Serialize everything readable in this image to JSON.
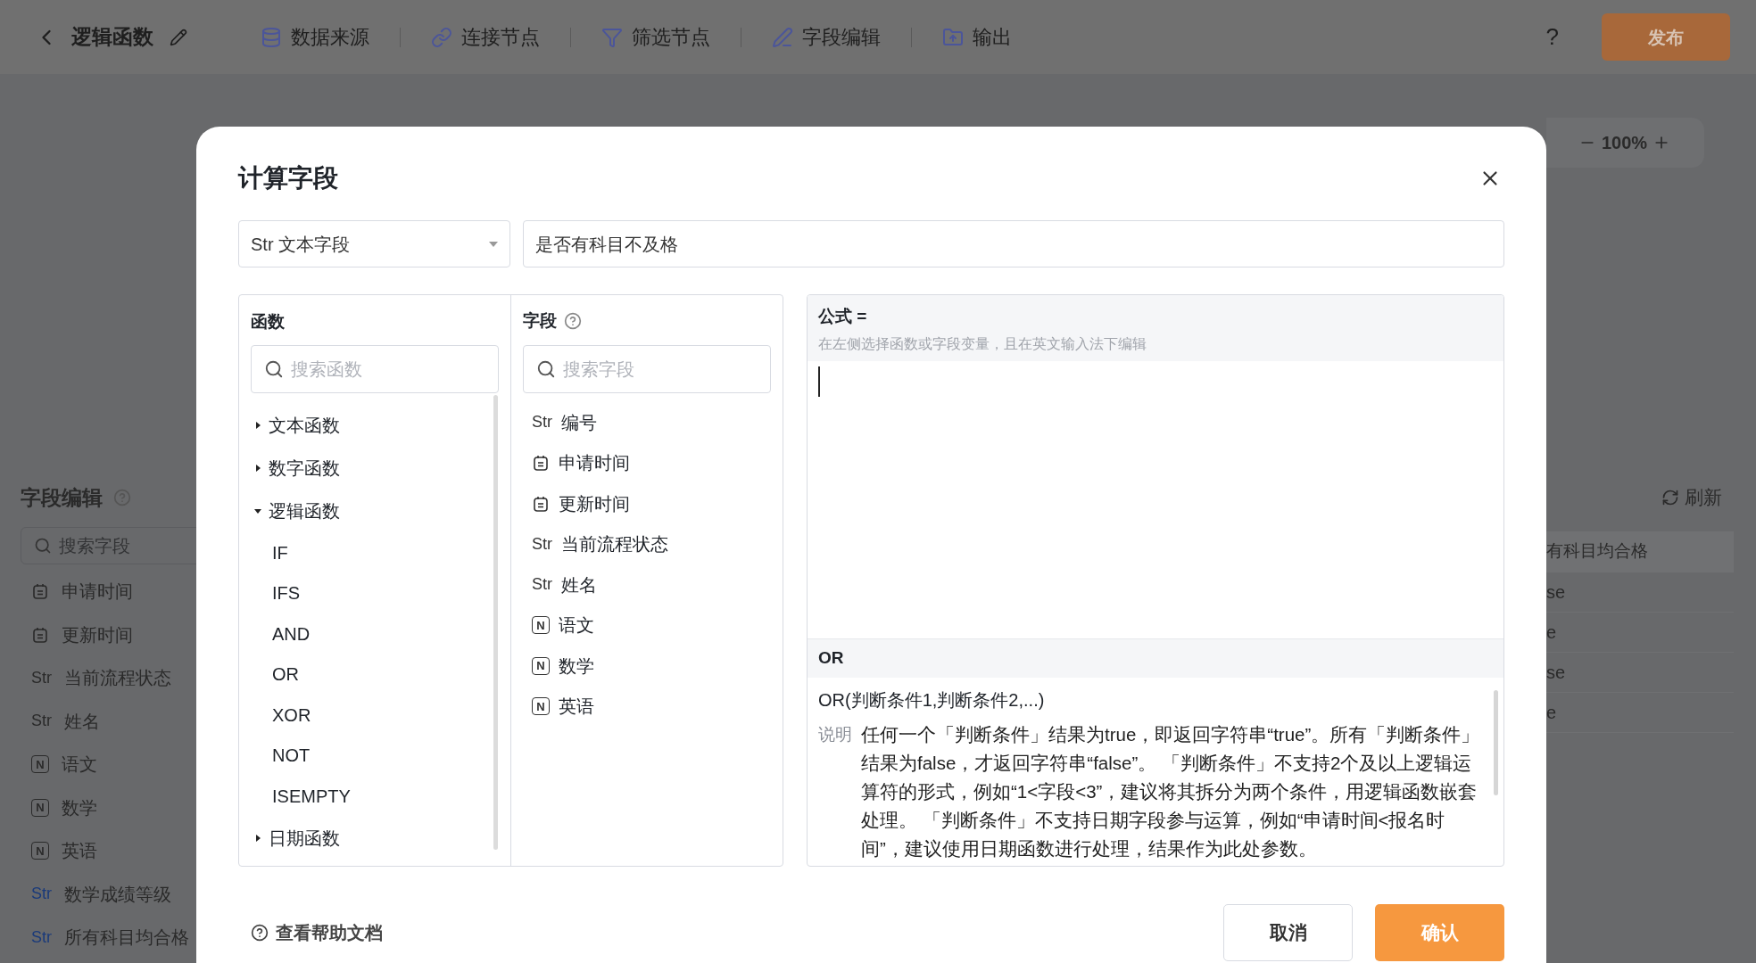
{
  "top_bar": {
    "title": "逻辑函数",
    "nav": [
      {
        "label": "数据来源",
        "kind": "source"
      },
      {
        "label": "连接节点",
        "kind": "join"
      },
      {
        "label": "筛选节点",
        "kind": "filter"
      },
      {
        "label": "字段编辑",
        "kind": "edit"
      },
      {
        "label": "输出",
        "kind": "output"
      }
    ],
    "help": "?",
    "publish": "发布"
  },
  "sidebar": {
    "title": "字段编辑",
    "search_placeholder": "搜索字段",
    "items": [
      {
        "kind": "date",
        "label": "申请时间"
      },
      {
        "kind": "date",
        "label": "更新时间"
      },
      {
        "kind": "str",
        "tag": "Str",
        "label": "当前流程状态"
      },
      {
        "kind": "str",
        "tag": "Str",
        "label": "姓名"
      },
      {
        "kind": "num",
        "tag": "N",
        "label": "语文"
      },
      {
        "kind": "num",
        "tag": "N",
        "label": "数学"
      },
      {
        "kind": "num",
        "tag": "N",
        "label": "英语"
      },
      {
        "kind": "calc",
        "tag": "Str",
        "label": "数学成绩等级"
      },
      {
        "kind": "calc",
        "tag": "Str",
        "label": "所有科目均合格"
      }
    ]
  },
  "zoom": {
    "value": "100%"
  },
  "refresh": "刷新",
  "table": {
    "header": "有科目均合格",
    "rows": [
      "se",
      "e",
      "se",
      "e"
    ]
  },
  "dialog": {
    "title": "计算字段",
    "type_select": "Str 文本字段",
    "name_value": "是否有科目不及格",
    "functions": {
      "title": "函数",
      "search_placeholder": "搜索函数",
      "categories": [
        {
          "label": "文本函数",
          "expanded": false
        },
        {
          "label": "数字函数",
          "expanded": false
        },
        {
          "label": "逻辑函数",
          "expanded": true,
          "children": [
            "IF",
            "IFS",
            "AND",
            "OR",
            "XOR",
            "NOT",
            "ISEMPTY"
          ]
        },
        {
          "label": "日期函数",
          "expanded": false
        }
      ]
    },
    "fields": {
      "title": "字段",
      "search_placeholder": "搜索字段",
      "items": [
        {
          "kind": "str",
          "tag": "Str",
          "label": "编号"
        },
        {
          "kind": "date",
          "label": "申请时间"
        },
        {
          "kind": "date",
          "label": "更新时间"
        },
        {
          "kind": "str",
          "tag": "Str",
          "label": "当前流程状态"
        },
        {
          "kind": "str",
          "tag": "Str",
          "label": "姓名"
        },
        {
          "kind": "num",
          "tag": "N",
          "label": "语文"
        },
        {
          "kind": "num",
          "tag": "N",
          "label": "数学"
        },
        {
          "kind": "num",
          "tag": "N",
          "label": "英语"
        }
      ]
    },
    "formula": {
      "label": "公式 =",
      "hint": "在左侧选择函数或字段变量，且在英文输入法下编辑"
    },
    "doc": {
      "name": "OR",
      "signature": "OR(判断条件1,判断条件2,...)",
      "desc_label": "说明",
      "description": "任何一个「判断条件」结果为true，即返回字符串“true”。所有「判断条件」结果为false，才返回字符串“false”。 「判断条件」不支持2个及以上逻辑运算符的形式，例如“1<字段<3”，建议将其拆分为两个条件，用逻辑函数嵌套处理。 「判断条件」不支持日期字段参与运算，例如“申请时间<报名时间”，建议使用日期函数进行处理，结果作为此处参数。"
    },
    "help_link": "查看帮助文档",
    "cancel": "取消",
    "confirm": "确认"
  }
}
